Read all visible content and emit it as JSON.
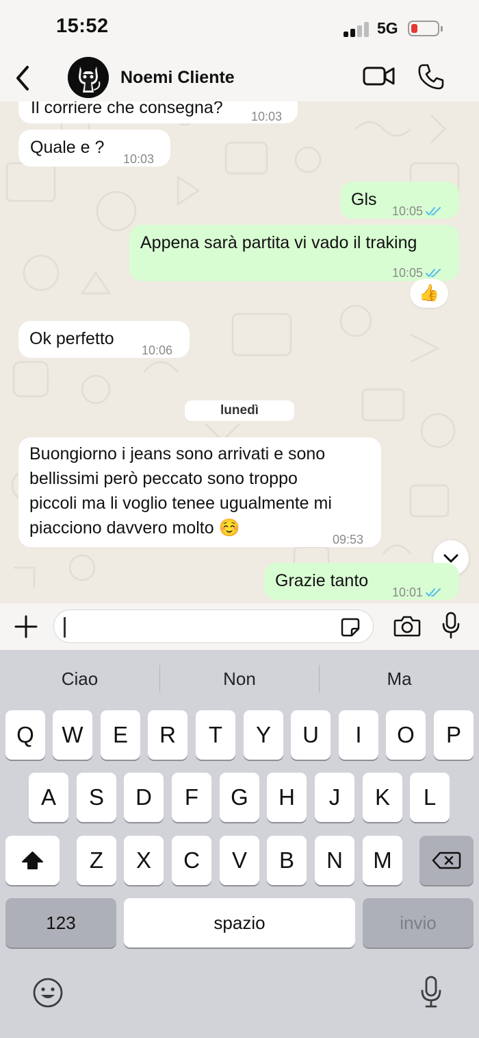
{
  "status_bar": {
    "time": "15:52",
    "network": "5G"
  },
  "header": {
    "contact_name": "Noemi Cliente",
    "back_icon": "chevron-left",
    "video_icon": "video-camera",
    "call_icon": "phone"
  },
  "messages": [
    {
      "direction": "in",
      "text": "Il corriere che consegna?",
      "time": "10:03"
    },
    {
      "direction": "in",
      "text": "Quale e ?",
      "time": "10:03"
    },
    {
      "direction": "out",
      "text": "Gls",
      "time": "10:05",
      "read": true
    },
    {
      "direction": "out",
      "text": "Appena sarà partita vi vado il traking",
      "time": "10:05",
      "read": true,
      "reaction": "👍"
    },
    {
      "direction": "in",
      "text": "Ok perfetto",
      "time": "10:06"
    },
    {
      "direction": "in",
      "lines": [
        "Buongiorno i jeans sono arrivati e sono",
        "bellissimi però peccato sono troppo",
        "piccoli ma li voglio tenee ugualmente mi",
        "piacciono davvero molto ☺️"
      ],
      "time": "09:53"
    },
    {
      "direction": "out",
      "text": "Grazie tanto",
      "time": "10:01",
      "read": true
    }
  ],
  "date_separator": "lunedì",
  "input": {
    "placeholder": ""
  },
  "keyboard": {
    "suggestions": [
      "Ciao",
      "Non",
      "Ma"
    ],
    "row1": [
      "Q",
      "W",
      "E",
      "R",
      "T",
      "Y",
      "U",
      "I",
      "O",
      "P"
    ],
    "row2": [
      "A",
      "S",
      "D",
      "F",
      "G",
      "H",
      "J",
      "K",
      "L"
    ],
    "row3": [
      "Z",
      "X",
      "C",
      "V",
      "B",
      "N",
      "M"
    ],
    "numbers_key": "123",
    "space_key": "spazio",
    "return_key": "invio"
  },
  "colors": {
    "incoming_bubble": "#ffffff",
    "outgoing_bubble": "#d9fdd3",
    "read_ticks": "#53bdeb",
    "chat_background": "#efeae2",
    "keyboard_background": "#d1d3d9"
  }
}
